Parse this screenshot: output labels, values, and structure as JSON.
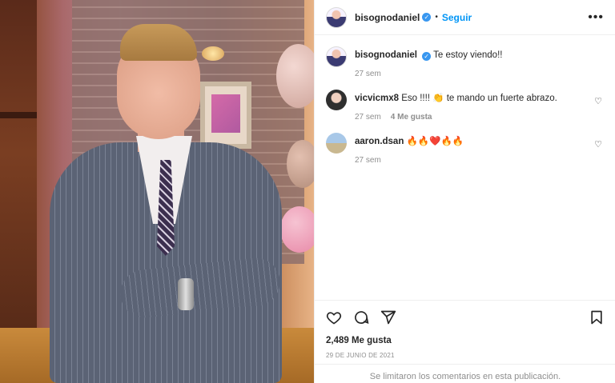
{
  "post": {
    "author": "bisognodaniel",
    "follow_label": "Seguir",
    "separator": "•",
    "caption": "Te estoy viendo!!",
    "caption_time": "27 sem",
    "likes": "2,489 Me gusta",
    "date": "29 DE JUNIO DE 2021",
    "comments_limited": "Se limitaron los comentarios en esta publicación."
  },
  "comments": [
    {
      "user": "vicvicmx8",
      "text": "Eso !!!! 👏 te mando un fuerte abrazo.",
      "time": "27 sem",
      "likes": "4 Me gusta"
    },
    {
      "user": "aaron.dsan",
      "text": "🔥🔥❤️🔥🔥",
      "time": "27 sem"
    }
  ],
  "icons": {
    "more": "more-options-icon",
    "like": "heart-icon",
    "comment": "comment-icon",
    "share": "share-icon",
    "save": "bookmark-icon",
    "verified": "verified-badge-icon"
  },
  "colors": {
    "follow": "#0095f6",
    "verified": "#3897f0",
    "muted": "#8e8e8e"
  }
}
